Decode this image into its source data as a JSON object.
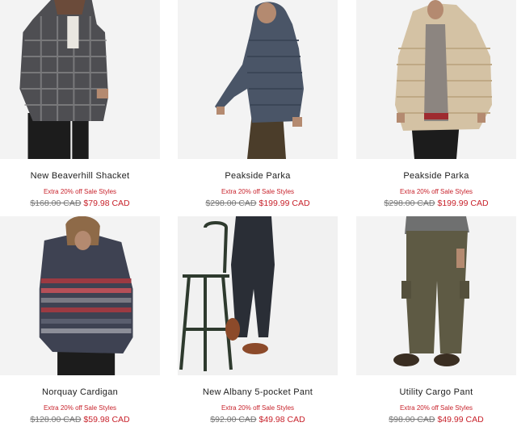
{
  "products": [
    {
      "name": "New Beaverhill Shacket",
      "promo": "Extra 20% off Sale Styles",
      "old_price": "$168.00 CAD",
      "new_price": "$79.98 CAD",
      "image": "man-in-plaid-shacket"
    },
    {
      "name": "Peakside Parka",
      "promo": "Extra 20% off Sale Styles",
      "old_price": "$298.00 CAD",
      "new_price": "$199.99 CAD",
      "image": "man-in-navy-puffer-parka"
    },
    {
      "name": "Peakside Parka",
      "promo": "Extra 20% off Sale Styles",
      "old_price": "$298.00 CAD",
      "new_price": "$199.99 CAD",
      "image": "man-in-beige-puffer-parka"
    },
    {
      "name": "Norquay Cardigan",
      "promo": "Extra 20% off Sale Styles",
      "old_price": "$128.00 CAD",
      "new_price": "$59.98 CAD",
      "image": "man-in-striped-cardigan"
    },
    {
      "name": "New Albany 5-pocket Pant",
      "promo": "Extra 20% off Sale Styles",
      "old_price": "$92.00 CAD",
      "new_price": "$49.98 CAD",
      "image": "man-in-black-pants-by-stool"
    },
    {
      "name": "Utility Cargo Pant",
      "promo": "Extra 20% off Sale Styles",
      "old_price": "$98.00 CAD",
      "new_price": "$49.99 CAD",
      "image": "man-in-olive-cargo-pants"
    }
  ]
}
